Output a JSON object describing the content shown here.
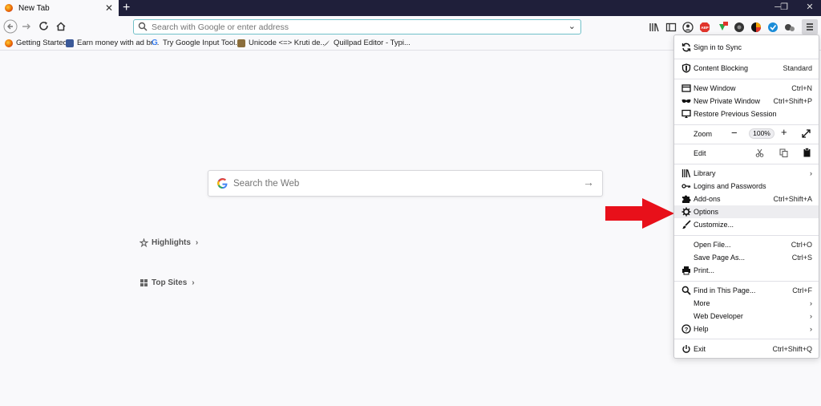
{
  "tab": {
    "title": "New Tab"
  },
  "urlbar": {
    "placeholder": "Search with Google or enter address"
  },
  "bookmarks": [
    {
      "label": "Getting Started"
    },
    {
      "label": "Earn money with ad br..."
    },
    {
      "label": "Try Google Input Tool..."
    },
    {
      "label": "Unicode <=> Kruti de..."
    },
    {
      "label": "Quillpad Editor - Typi..."
    }
  ],
  "newtab": {
    "search_placeholder": "Search the Web",
    "highlights": "Highlights",
    "top_sites": "Top Sites"
  },
  "menu": {
    "sync": "Sign in to Sync",
    "content_blocking": "Content Blocking",
    "content_blocking_value": "Standard",
    "new_window": "New Window",
    "new_window_key": "Ctrl+N",
    "new_private": "New Private Window",
    "new_private_key": "Ctrl+Shift+P",
    "restore": "Restore Previous Session",
    "zoom": "Zoom",
    "zoom_value": "100%",
    "edit": "Edit",
    "library": "Library",
    "logins": "Logins and Passwords",
    "addons": "Add-ons",
    "addons_key": "Ctrl+Shift+A",
    "options": "Options",
    "customize": "Customize...",
    "open_file": "Open File...",
    "open_file_key": "Ctrl+O",
    "save_page": "Save Page As...",
    "save_page_key": "Ctrl+S",
    "print": "Print...",
    "find": "Find in This Page...",
    "find_key": "Ctrl+F",
    "more": "More",
    "web_dev": "Web Developer",
    "help": "Help",
    "exit": "Exit",
    "exit_key": "Ctrl+Shift+Q"
  },
  "colors": {
    "titlebar": "#1f1f3a",
    "annotation_arrow": "#e8101a",
    "highlight": "#ededf0"
  }
}
